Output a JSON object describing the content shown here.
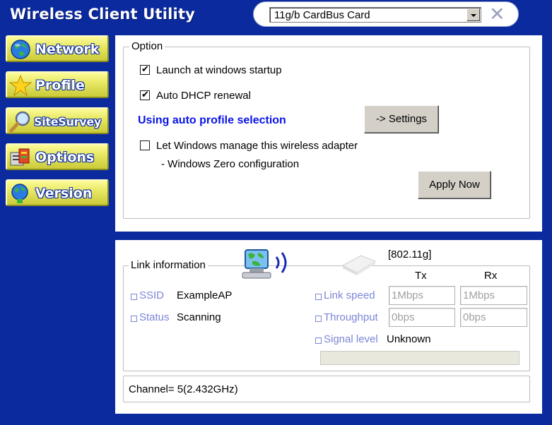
{
  "app": {
    "title": "Wireless Client Utility"
  },
  "adapter": {
    "selected": "11g/b CardBus Card"
  },
  "nav": [
    {
      "label": "Network",
      "icon": "globe-icon"
    },
    {
      "label": "Profile",
      "icon": "star-icon"
    },
    {
      "label": "SiteSurvey",
      "icon": "magnifier-icon"
    },
    {
      "label": "Options",
      "icon": "options-icon"
    },
    {
      "label": "Version",
      "icon": "globe-person-icon"
    }
  ],
  "option": {
    "legend": "Option",
    "launch_startup": {
      "label": "Launch at windows startup",
      "checked": true
    },
    "auto_dhcp": {
      "label": "Auto DHCP renewal",
      "checked": true
    },
    "auto_profile_text": "Using auto profile selection",
    "settings_button": "-> Settings",
    "windows_manage": {
      "label": "Let Windows manage this wireless adapter",
      "checked": false
    },
    "zero_config_text": "- Windows Zero configuration",
    "apply_button": "Apply Now"
  },
  "link": {
    "legend": "Link information",
    "standard": "[802.11g]",
    "tx_header": "Tx",
    "rx_header": "Rx",
    "ssid_label": "SSID",
    "ssid_value": "ExampleAP",
    "status_label": "Status",
    "status_value": "Scanning",
    "link_speed_label": "Link speed",
    "link_speed_tx": "1Mbps",
    "link_speed_rx": "1Mbps",
    "throughput_label": "Throughput",
    "throughput_tx": "0bps",
    "throughput_rx": "0bps",
    "signal_label": "Signal level",
    "signal_value": "Unknown"
  },
  "channel": {
    "text": "Channel= 5(2.432GHz)"
  },
  "colors": {
    "background": "#0a2a9e",
    "nav_button": "#e6e660",
    "accent_text": "#0a14e6"
  }
}
